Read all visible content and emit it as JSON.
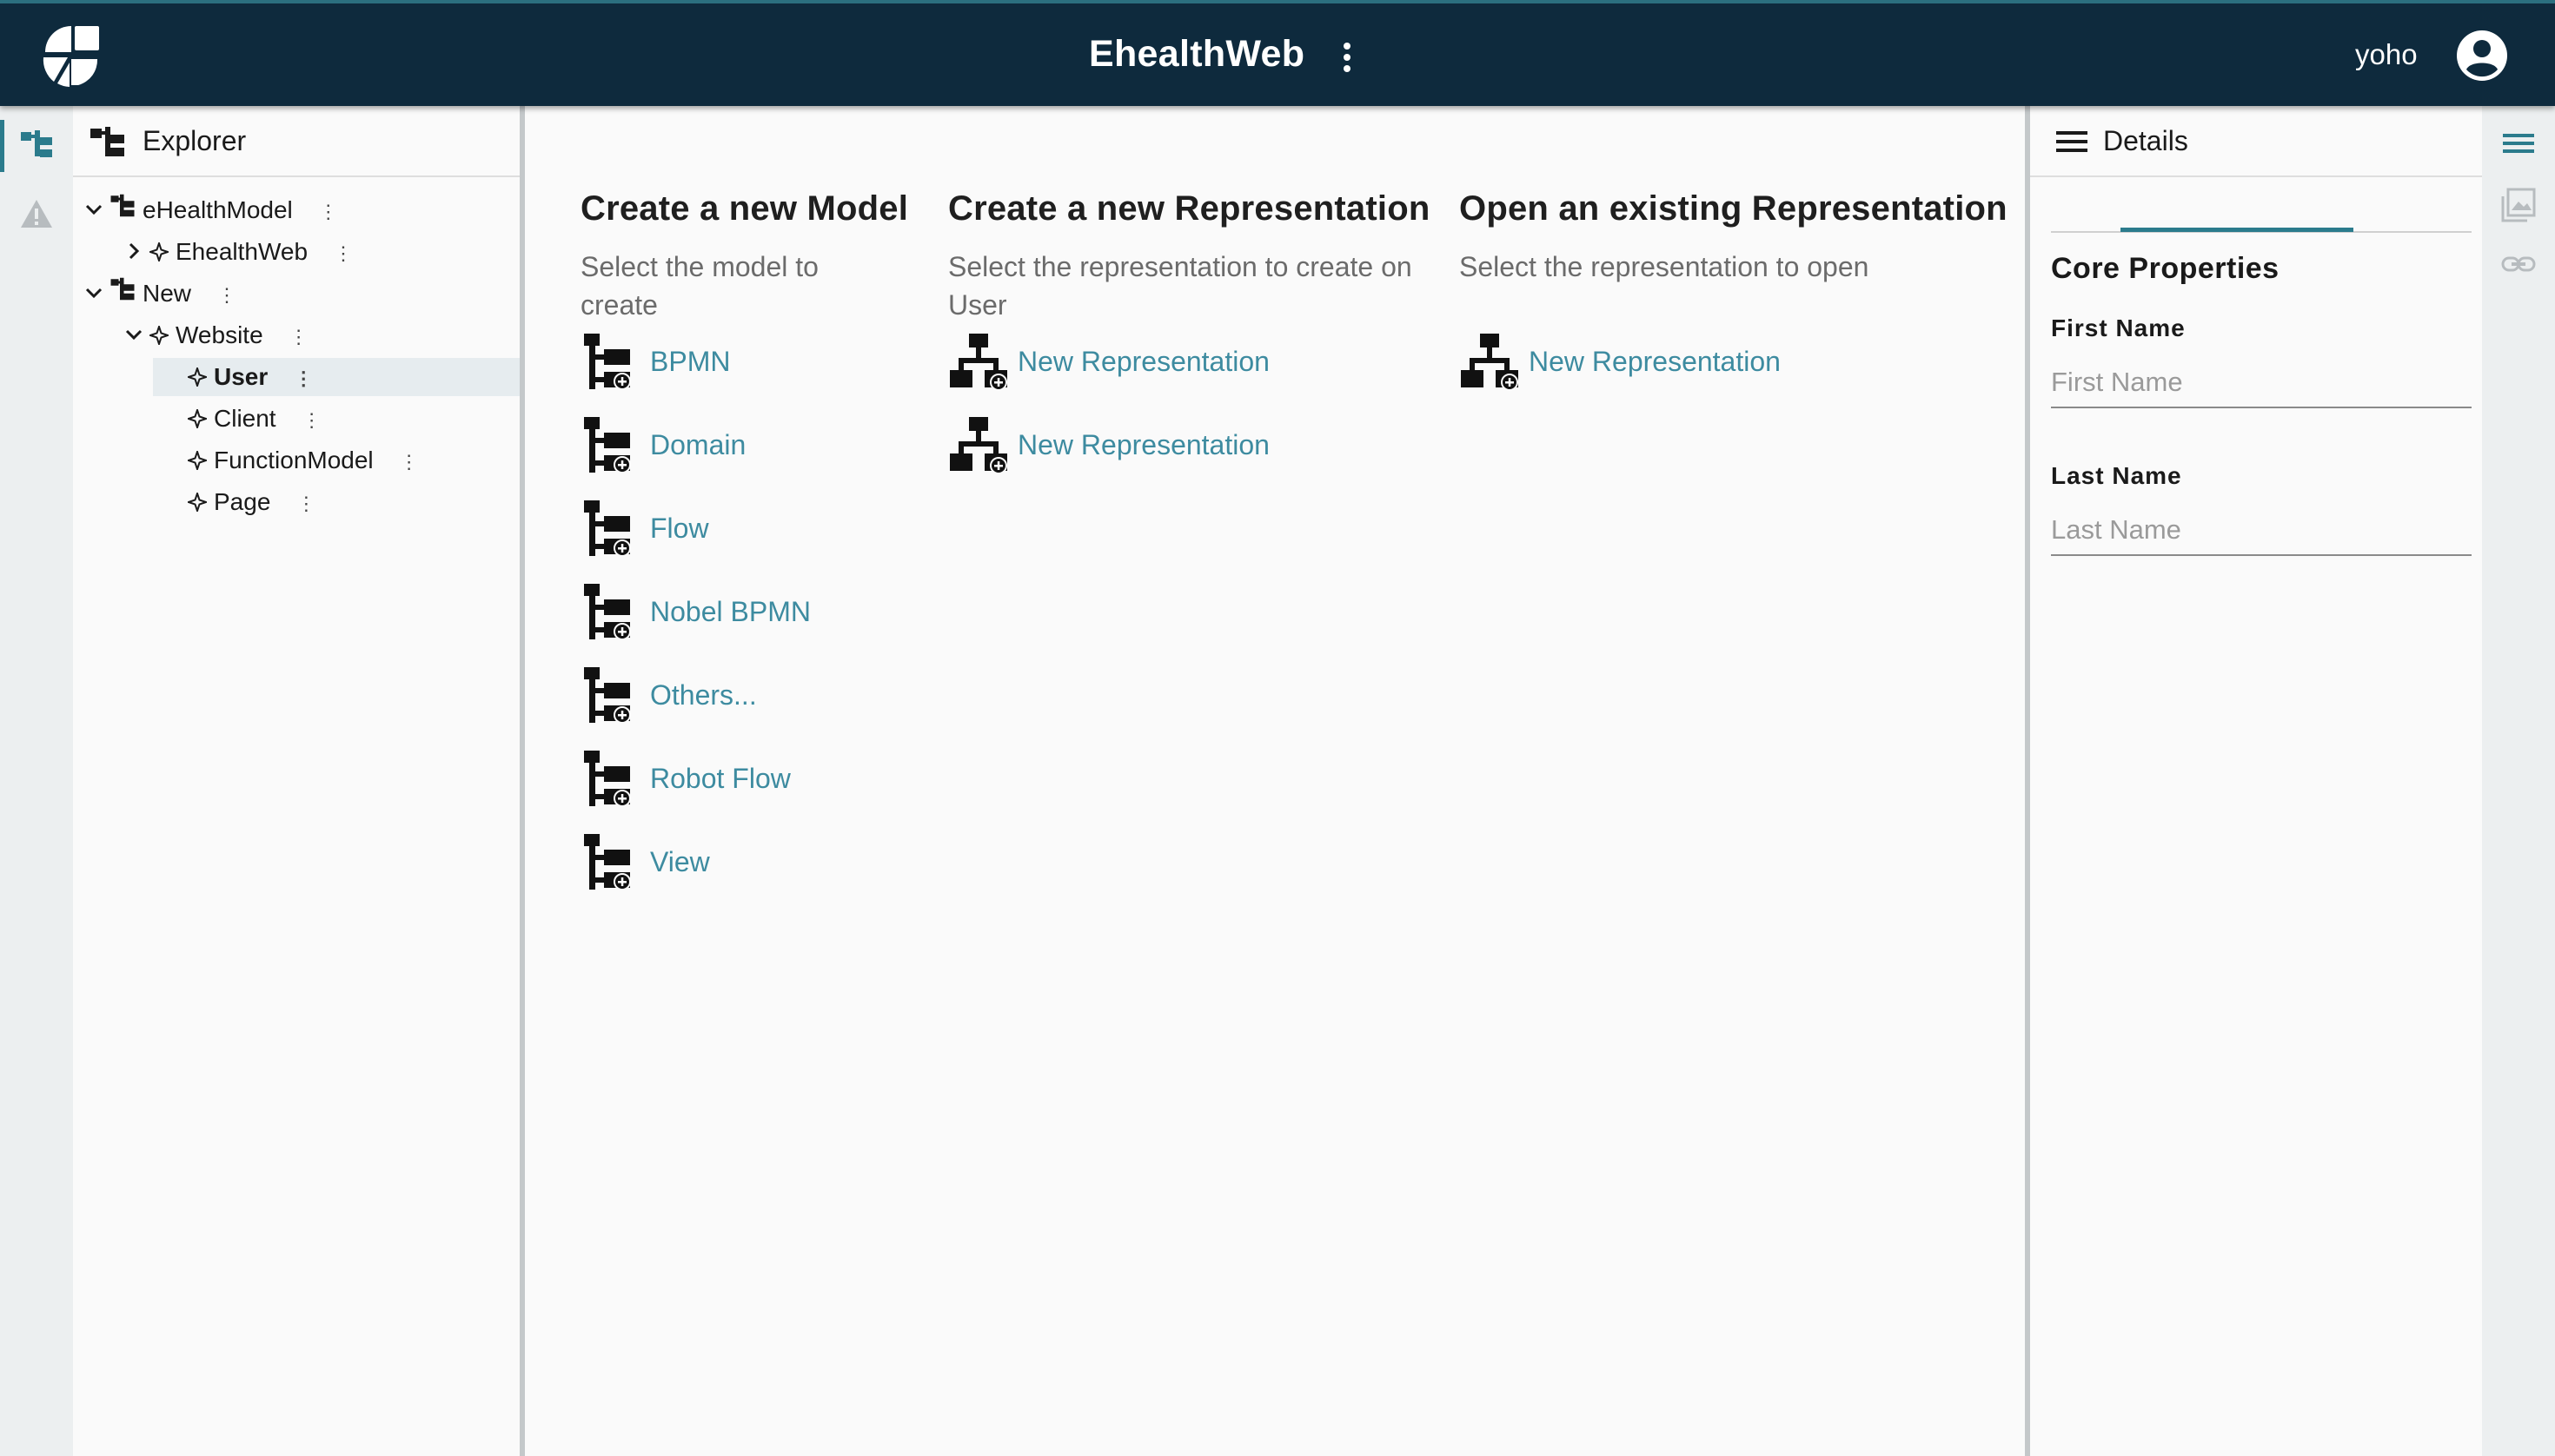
{
  "app": {
    "title": "EhealthWeb",
    "user": "yoho",
    "brand_color": "#0e2a3d",
    "accent_color": "#2b7b8c",
    "link_color": "#3d8ba0"
  },
  "explorer": {
    "title": "Explorer",
    "tree": [
      {
        "label": "eHealthModel",
        "icon": "model-icon",
        "expander": "expanded",
        "level": 0
      },
      {
        "label": "EhealthWeb",
        "icon": "object-icon",
        "expander": "collapsed",
        "level": 1
      },
      {
        "label": "New",
        "icon": "model-icon",
        "expander": "expanded",
        "level": 0
      },
      {
        "label": "Website",
        "icon": "object-icon",
        "expander": "expanded",
        "level": 1
      },
      {
        "label": "User",
        "icon": "object-icon",
        "expander": "none",
        "level": 2,
        "selected": true
      },
      {
        "label": "Client",
        "icon": "object-icon",
        "expander": "none",
        "level": 2
      },
      {
        "label": "FunctionModel",
        "icon": "object-icon",
        "expander": "none",
        "level": 2
      },
      {
        "label": "Page",
        "icon": "object-icon",
        "expander": "none",
        "level": 2
      }
    ]
  },
  "main": {
    "create_model": {
      "title": "Create a new Model",
      "subtitle": "Select the model to create",
      "items": [
        "BPMN",
        "Domain",
        "Flow",
        "Nobel BPMN",
        "Others...",
        "Robot Flow",
        "View"
      ]
    },
    "create_representation": {
      "title": "Create a new Representation",
      "subtitle": "Select the representation to create on User",
      "items": [
        "New Representation",
        "New Representation"
      ]
    },
    "open_representation": {
      "title": "Open an existing Representation",
      "subtitle": "Select the representation to open",
      "items": [
        "New Representation"
      ]
    }
  },
  "details": {
    "title": "Details",
    "section": "Core Properties",
    "fields": [
      {
        "label": "First Name",
        "placeholder": "First Name",
        "value": ""
      },
      {
        "label": "Last Name",
        "placeholder": "Last Name",
        "value": ""
      }
    ]
  }
}
